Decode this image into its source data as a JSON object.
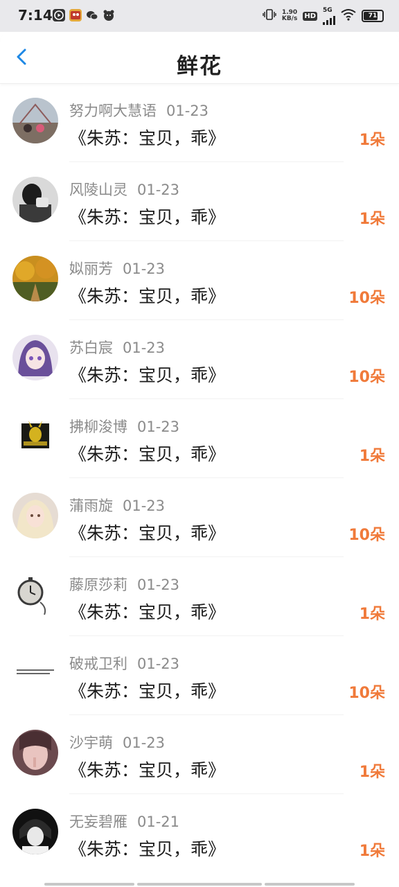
{
  "status_bar": {
    "time": "7:14",
    "speed_top": "1.90",
    "speed_unit": "KB/s",
    "hd": "HD",
    "net": "5G",
    "battery": "71"
  },
  "header": {
    "title": "鲜花"
  },
  "items": [
    {
      "name": "努力啊大慧语",
      "date": "01-23",
      "message": "《朱苏：宝贝，乖》",
      "count": "1朵"
    },
    {
      "name": "风陵山灵",
      "date": "01-23",
      "message": "《朱苏：宝贝，乖》",
      "count": "1朵"
    },
    {
      "name": "姒丽芳",
      "date": "01-23",
      "message": "《朱苏：宝贝，乖》",
      "count": "10朵"
    },
    {
      "name": "苏白宸",
      "date": "01-23",
      "message": "《朱苏：宝贝，乖》",
      "count": "10朵"
    },
    {
      "name": "拂柳浚博",
      "date": "01-23",
      "message": "《朱苏：宝贝，乖》",
      "count": "1朵"
    },
    {
      "name": "蒲雨旋",
      "date": "01-23",
      "message": "《朱苏：宝贝，乖》",
      "count": "10朵"
    },
    {
      "name": "藤原莎莉",
      "date": "01-23",
      "message": "《朱苏：宝贝，乖》",
      "count": "1朵"
    },
    {
      "name": "破戒卫利",
      "date": "01-23",
      "message": "《朱苏：宝贝，乖》",
      "count": "10朵"
    },
    {
      "name": "沙宇萌",
      "date": "01-23",
      "message": "《朱苏：宝贝，乖》",
      "count": "1朵"
    },
    {
      "name": "无妄碧雁",
      "date": "01-21",
      "message": "《朱苏：宝贝，乖》",
      "count": "1朵"
    }
  ],
  "colors": {
    "accent_count": "#f07a3a",
    "back_arrow": "#1e88e5",
    "name_gray": "#8b8b8b"
  }
}
